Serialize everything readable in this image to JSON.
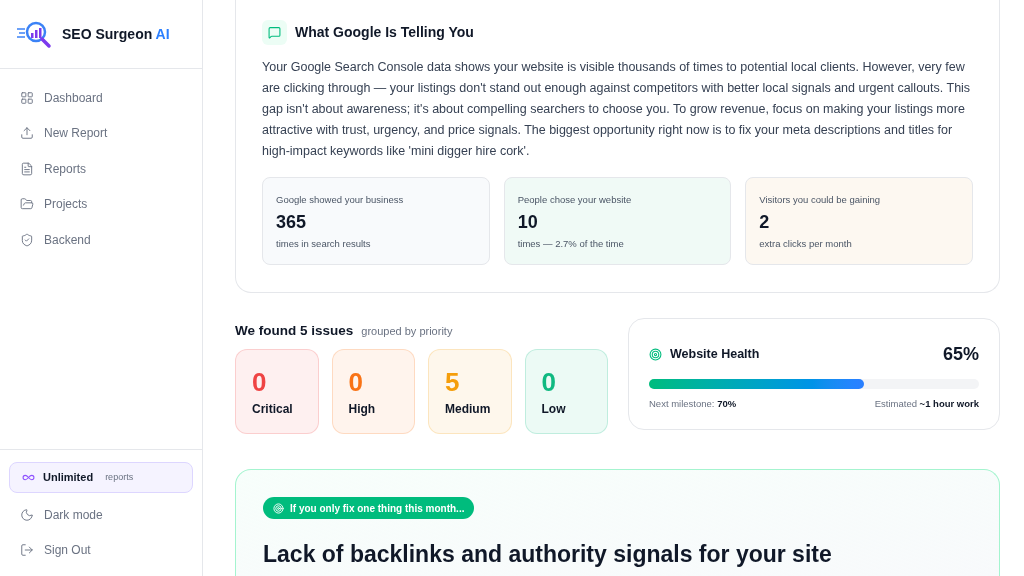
{
  "sidebar": {
    "brand": {
      "name": "SEO Surgeon",
      "accent": "AI"
    },
    "nav": [
      {
        "kind": "dashboard",
        "label": "Dashboard"
      },
      {
        "kind": "upload",
        "label": "New Report"
      },
      {
        "kind": "file",
        "label": "Reports"
      },
      {
        "kind": "folder",
        "label": "Projects"
      },
      {
        "kind": "shield",
        "label": "Backend"
      }
    ],
    "plan": {
      "title": "Unlimited",
      "note": "reports"
    },
    "footer": [
      {
        "kind": "moon",
        "label": "Dark mode"
      },
      {
        "kind": "signout",
        "label": "Sign Out"
      }
    ]
  },
  "insight": {
    "title": "What Google Is Telling You",
    "body": "Your Google Search Console data shows your website is visible thousands of times to potential local clients. However, very few are clicking through — your listings don't stand out enough against competitors with better local signals and urgent callouts. This gap isn't about awareness; it's about compelling searchers to choose you. To grow revenue, focus on making your listings more attractive with trust, urgency, and price signals. The biggest opportunity right now is to fix your meta descriptions and titles for high-impact keywords like 'mini digger hire cork'.",
    "stats": [
      {
        "label": "Google showed your business",
        "value": "365",
        "note": "times in search results",
        "color": "#f8fafc"
      },
      {
        "label": "People chose your website",
        "value": "10",
        "note": "times — 2.7% of the time",
        "color": "#f0faf6"
      },
      {
        "label": "Visitors you could be gaining",
        "value": "2",
        "note": "extra clicks per month",
        "color": "#fdf8f1"
      }
    ]
  },
  "issues": {
    "title": "We found 5 issues",
    "subtitle": "grouped by priority",
    "counts": [
      {
        "value": "0",
        "label": "Critical",
        "color": "#ef4444"
      },
      {
        "value": "0",
        "label": "High",
        "color": "#f97316"
      },
      {
        "value": "5",
        "label": "Medium",
        "color": "#f59e0b"
      },
      {
        "value": "0",
        "label": "Low",
        "color": "#10b981"
      }
    ]
  },
  "health": {
    "title": "Website Health",
    "percent": "65%",
    "level": 0.65,
    "milestone_label": "Next milestone:",
    "milestone": "70%",
    "estimate_label": "Estimated",
    "estimate": "~1 hour work"
  },
  "focus": {
    "badge": "If you only fix one thing this month...",
    "title": "Lack of backlinks and authority signals for your site"
  }
}
